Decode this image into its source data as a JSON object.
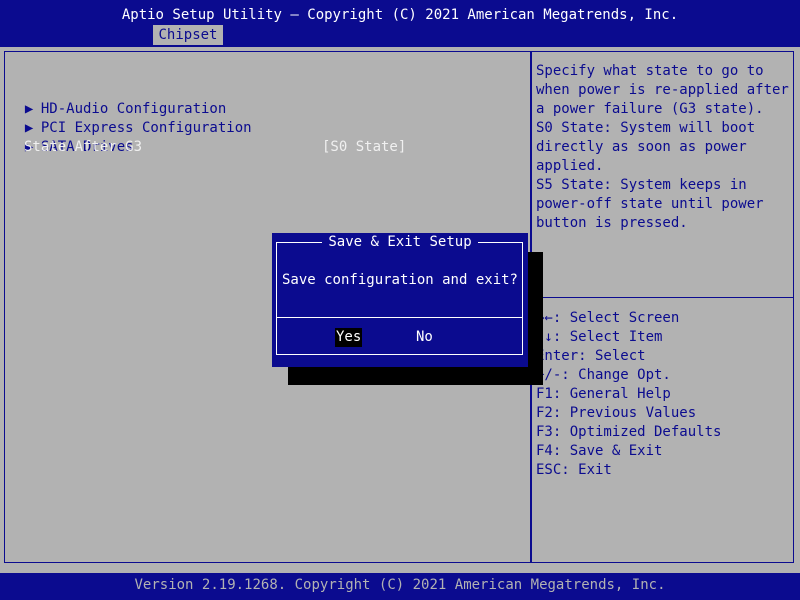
{
  "header": {
    "title": "Aptio Setup Utility – Copyright (C) 2021 American Megatrends, Inc.",
    "active_tab": "Chipset"
  },
  "menu": {
    "items": [
      {
        "label": "HD-Audio Configuration",
        "icon": "submenu-arrow-icon"
      },
      {
        "label": "PCI Express Configuration",
        "icon": "submenu-arrow-icon"
      },
      {
        "label": "SATA Drives",
        "icon": "submenu-arrow-icon"
      }
    ],
    "setting": {
      "label": "State After G3",
      "value": "[S0 State]"
    }
  },
  "help": {
    "text": "Specify what state to go to\nwhen power is re-applied after\na power failure (G3 state).\nS0 State: System will boot\ndirectly as soon as power\napplied.\nS5 State: System keeps in\npower-off state until power\nbutton is pressed."
  },
  "hints": [
    "→←: Select Screen",
    "↑↓: Select Item",
    "Enter: Select",
    "+/-: Change Opt.",
    "F1: General Help",
    "F2: Previous Values",
    "F3: Optimized Defaults",
    "F4: Save & Exit",
    "ESC: Exit"
  ],
  "dialog": {
    "title": "Save & Exit Setup",
    "message": "Save configuration and exit?",
    "yes_label": "Yes",
    "no_label": "No"
  },
  "footer": {
    "text": "Version 2.19.1268. Copyright (C) 2021 American Megatrends, Inc."
  },
  "colors": {
    "bios_blue": "#0b0b8f",
    "background_gray": "#b2b2b2",
    "highlight_white": "#f0f0f0"
  }
}
